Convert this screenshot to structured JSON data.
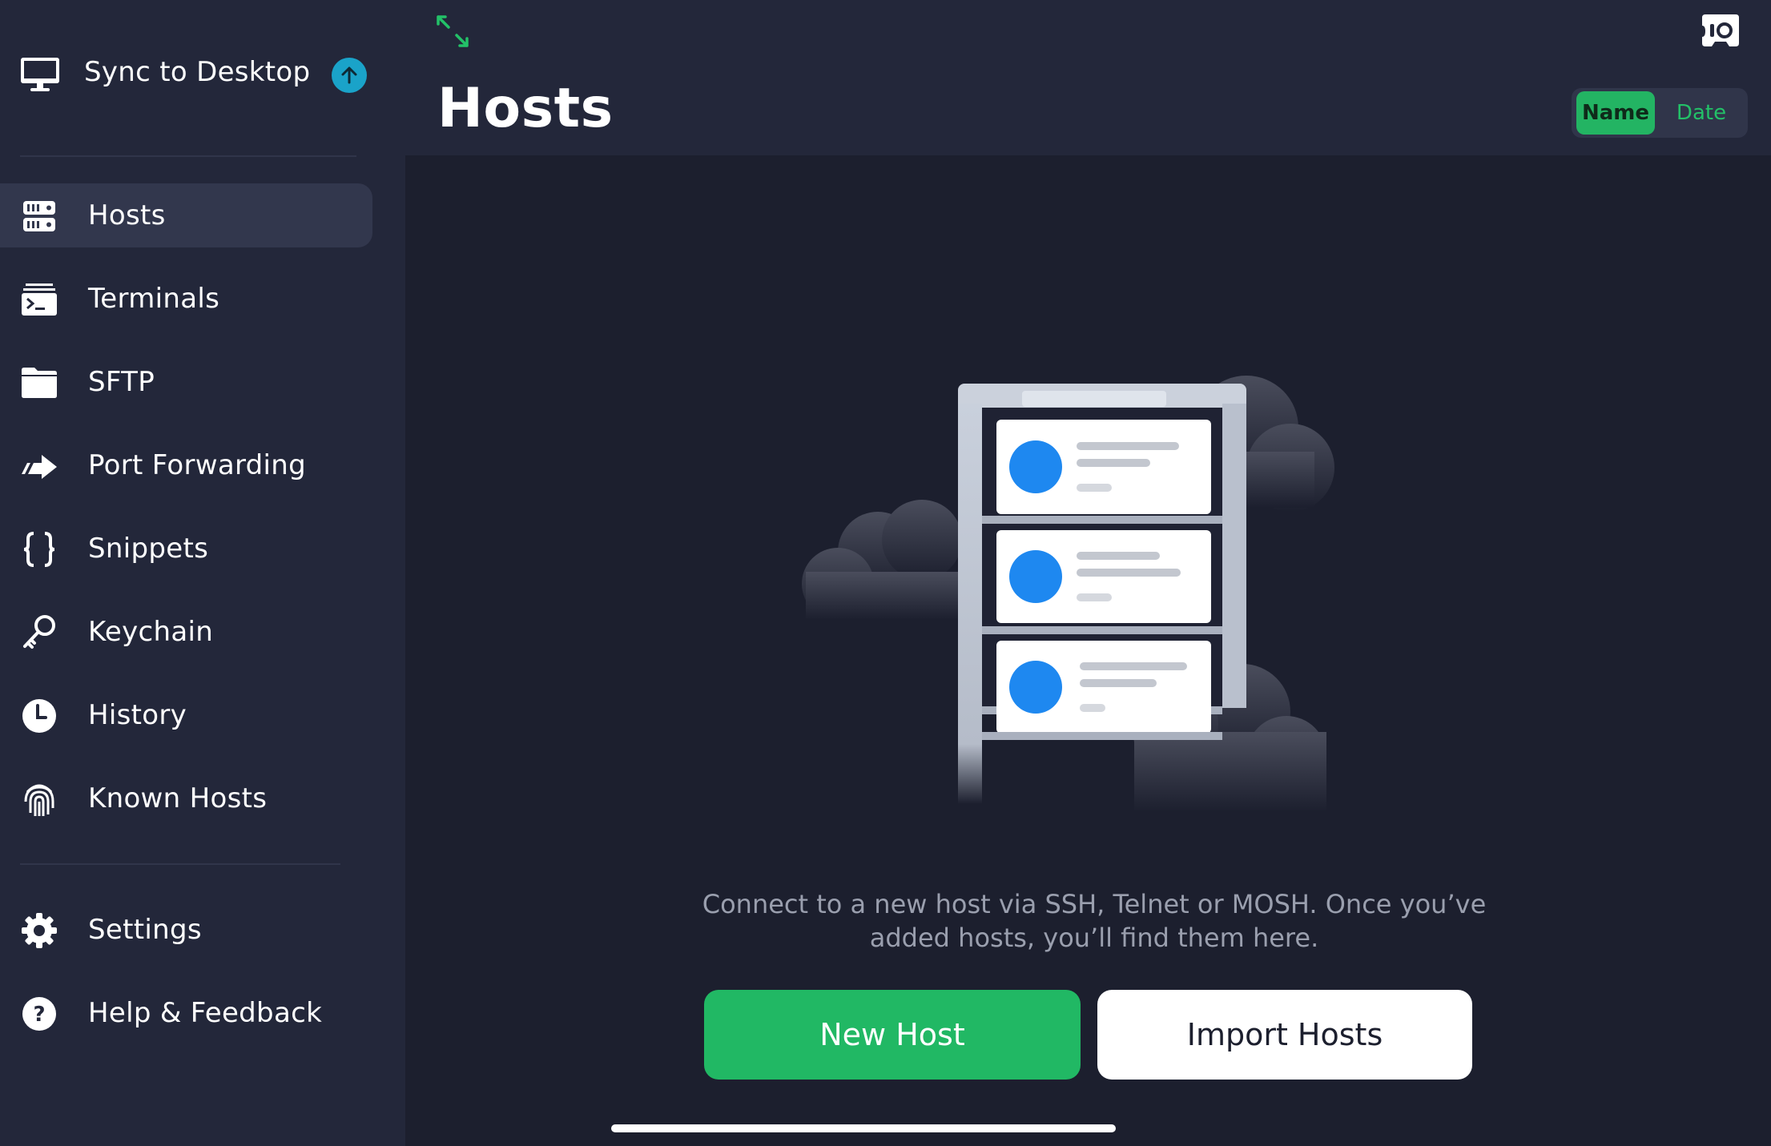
{
  "sidebar": {
    "sync": {
      "label": "Sync to Desktop",
      "icon": "monitor-icon",
      "badge_icon": "arrow-up-icon",
      "badge_color": "#1aa3c9"
    },
    "items": [
      {
        "label": "Hosts",
        "icon": "server-rack-icon",
        "active": true
      },
      {
        "label": "Terminals",
        "icon": "terminal-icon",
        "active": false
      },
      {
        "label": "SFTP",
        "icon": "folder-icon",
        "active": false
      },
      {
        "label": "Port Forwarding",
        "icon": "port-forward-arrow-icon",
        "active": false
      },
      {
        "label": "Snippets",
        "icon": "curly-braces-icon",
        "active": false
      },
      {
        "label": "Keychain",
        "icon": "key-icon",
        "active": false
      },
      {
        "label": "History",
        "icon": "clock-icon",
        "active": false
      },
      {
        "label": "Known Hosts",
        "icon": "fingerprint-icon",
        "active": false
      }
    ],
    "bottom_items": [
      {
        "label": "Settings",
        "icon": "gear-icon"
      },
      {
        "label": "Help & Feedback",
        "icon": "question-circle-icon"
      }
    ]
  },
  "header": {
    "title": "Hosts",
    "expand_icon": "expand-arrows-icon",
    "record_icon": "cassette-icon",
    "sort": {
      "options": [
        "Name",
        "Date"
      ],
      "selected": "Name"
    }
  },
  "empty_state": {
    "message": "Connect to a new host via SSH, Telnet or MOSH. Once you’ve added hosts, you’ll find them here.",
    "primary_button": "New Host",
    "secondary_button": "Import Hosts"
  },
  "colors": {
    "accent": "#21b864",
    "background": "#1c1f2e",
    "sidebar": "#23273a",
    "illustration_blue": "#1e88f0"
  }
}
